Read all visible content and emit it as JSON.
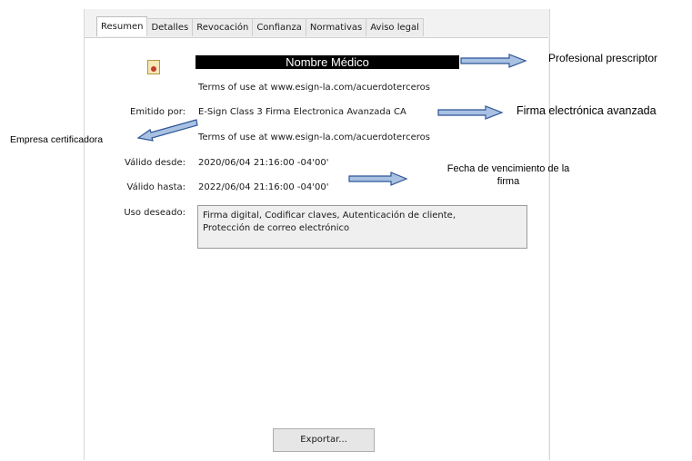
{
  "tabs": [
    "Resumen",
    "Detalles",
    "Revocación",
    "Confianza",
    "Normativas",
    "Aviso legal"
  ],
  "active_tab": "Resumen",
  "summary": {
    "name": "Nombre Médico",
    "terms_1": "Terms of use at www.esign-la.com/acuerdoterceros",
    "issued_by_label": "Emitido por:",
    "issued_by_value": "E-Sign Class 3 Firma Electronica Avanzada CA",
    "terms_2": "Terms of use at www.esign-la.com/acuerdoterceros",
    "valid_from_label": "Válido desde:",
    "valid_from_value": "2020/06/04 21:16:00 -04'00'",
    "valid_to_label": "Válido hasta:",
    "valid_to_value": "2022/06/04 21:16:00 -04'00'",
    "usage_label": "Uso deseado:",
    "usage_line_1": "Firma digital, Codificar claves, Autenticación de cliente,",
    "usage_line_2": "Protección de correo electrónico"
  },
  "export_label": "Exportar...",
  "annotations": {
    "prescriber": "Profesional prescriptor",
    "advanced_signature": "Firma electrónica avanzada",
    "certifier": "Empresa certificadora",
    "expiry_line_1": "Fecha de vencimiento de la",
    "expiry_line_2": "firma"
  },
  "colors": {
    "arrow_fill": "#a9c1e2",
    "arrow_stroke": "#2f5597",
    "name_bar": "#000000"
  }
}
